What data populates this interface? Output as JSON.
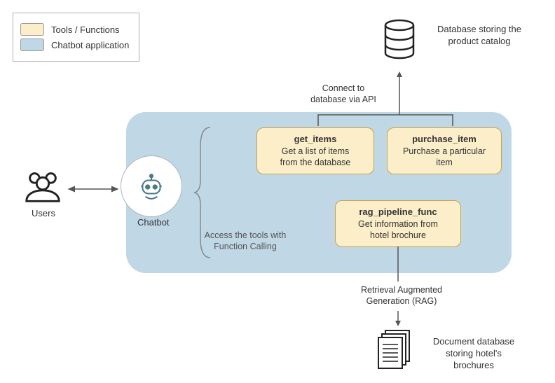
{
  "legend": {
    "tools_label": "Tools / Functions",
    "app_label": "Chatbot application"
  },
  "users_label": "Users",
  "chatbot_label": "Chatbot",
  "access_tools_label": "Access the tools with\nFunction Calling",
  "connect_db_label": "Connect to\ndatabase via API",
  "rag_label": "Retrieval Augmented\nGeneration (RAG)",
  "database": {
    "label": "Database storing the\nproduct catalog"
  },
  "documents": {
    "label": "Document database\nstoring hotel's\nbrochures"
  },
  "tools": {
    "get_items": {
      "title": "get_items",
      "desc": "Get a list of items\nfrom the database"
    },
    "purchase_item": {
      "title": "purchase_item",
      "desc": "Purchase a particular\nitem"
    },
    "rag_pipeline_func": {
      "title": "rag_pipeline_func",
      "desc": "Get information from\nhotel brochure"
    }
  }
}
